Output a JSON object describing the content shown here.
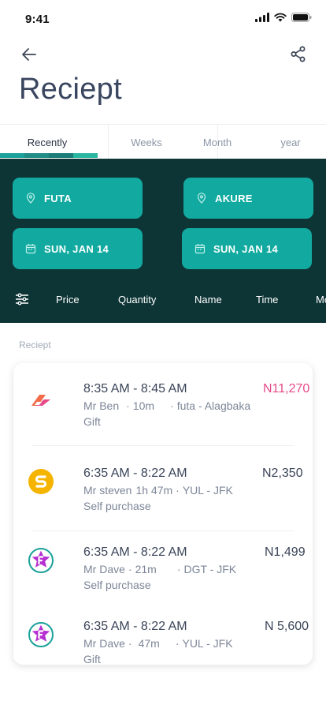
{
  "status_bar": {
    "time": "9:41"
  },
  "header": {
    "title": "Reciept"
  },
  "tabs": [
    {
      "label": "Recently",
      "active": true
    },
    {
      "label": "Weeks",
      "active": false
    },
    {
      "label": "Month",
      "active": false
    },
    {
      "label": "year",
      "active": false
    }
  ],
  "tab_indicator_colors": [
    "#1aa199",
    "#208d87",
    "#1c7c78",
    "#2bb6a0"
  ],
  "filters": {
    "from": "FUTA",
    "to": "AKURE",
    "depart_date": "SUN, JAN 14",
    "return_date": "SUN, JAN 14"
  },
  "sort_options": [
    "Price",
    "Quantity",
    "Name",
    "Time",
    "Mo"
  ],
  "section_label": "Reciept",
  "receipts": [
    {
      "logo": "bolt-logo-icon",
      "time_range": "8:35 AM - 8:45 AM",
      "name": "Mr Ben",
      "duration": "10m",
      "route": "futa - Alagbaka",
      "type": "Gift",
      "price": "N11,270",
      "price_color": "#e34a87"
    },
    {
      "logo": "s-coin-logo-icon",
      "time_range": "6:35 AM - 8:22 AM",
      "name": "Mr steven",
      "duration": "1h 47m",
      "route": "YUL - JFK",
      "type": "Self purchase",
      "price": "N2,350",
      "price_color": "#3a4458"
    },
    {
      "logo": "f-star-logo-icon",
      "time_range": "6:35 AM - 8:22 AM",
      "name": "Mr Dave",
      "duration": "21m",
      "route": "DGT - JFK",
      "type": "Self purchase",
      "price": "N1,499",
      "price_color": "#3a4458"
    },
    {
      "logo": "f-star-logo-icon",
      "time_range": "6:35 AM - 8:22 AM",
      "name": "Mr Dave",
      "duration": "47m",
      "route": "YUL - JFK",
      "type": "Gift",
      "price": "N 5,600",
      "price_color": "#3a4458"
    }
  ],
  "colors": {
    "accent": "#12aaa0",
    "panel": "#0e3536",
    "title": "#3a4660",
    "highlight_price": "#e34a87"
  }
}
